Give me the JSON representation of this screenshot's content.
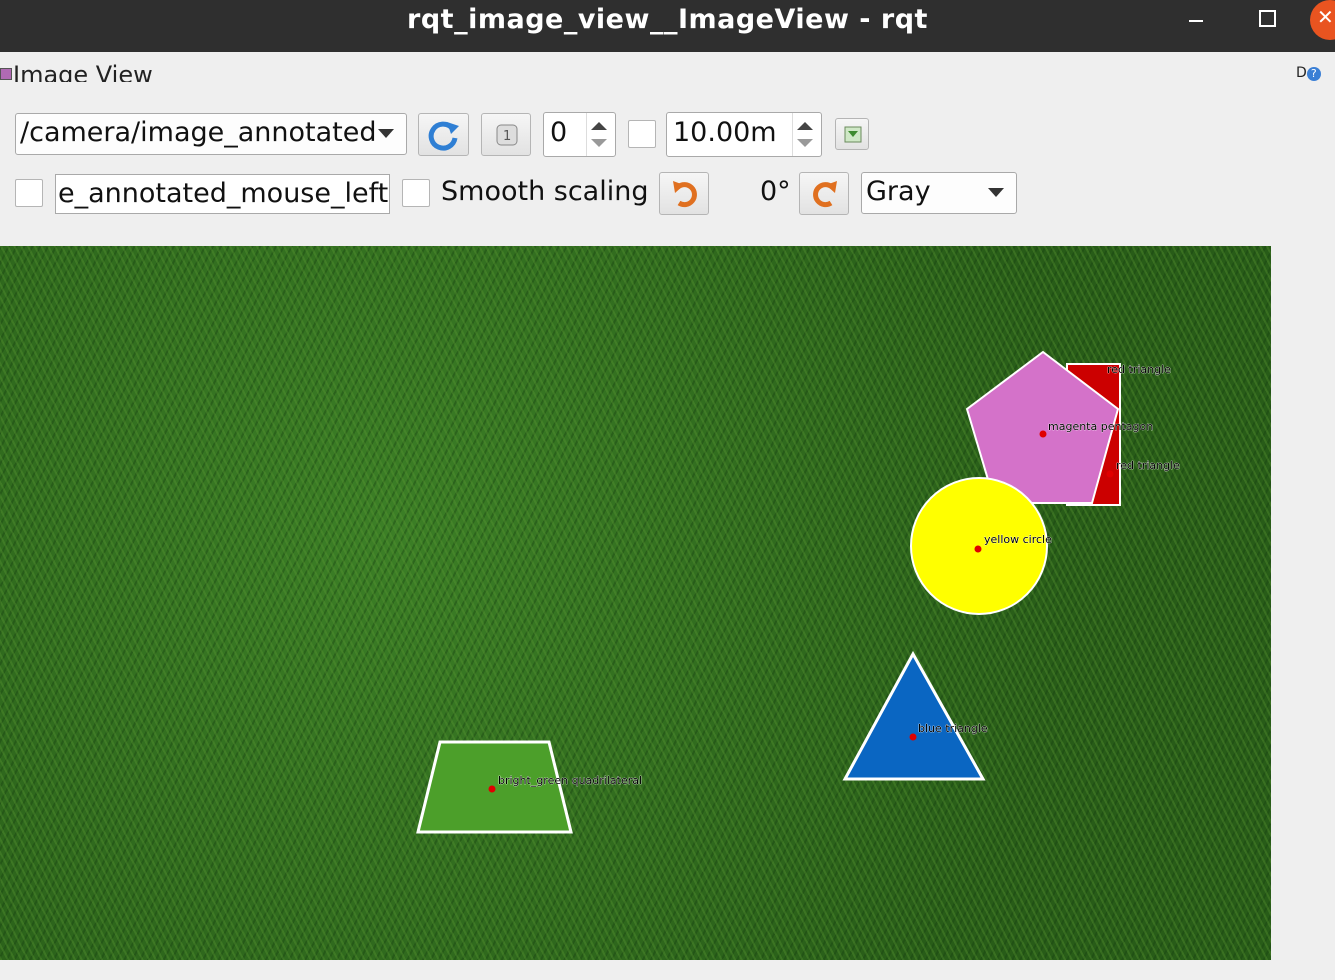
{
  "window": {
    "title": "rqt_image_view__ImageView - rqt"
  },
  "panel": {
    "title": "Image View",
    "help_text": "D"
  },
  "toolbar": {
    "topic": "/camera/image_annotated",
    "spin_value": "0",
    "duration": "10.00m",
    "mouse_topic": "e_annotated_mouse_left",
    "smooth_scaling_label": "Smooth scaling",
    "rotation": "0°",
    "color_scheme": "Gray"
  },
  "image": {
    "colors": {
      "yellow": "#ffff00",
      "magenta": "#d472c9",
      "red": "#cc0000",
      "blue": "#0a66c2",
      "green": "#4c9f2a"
    },
    "labels": {
      "red_triangle_1": "red triangle",
      "magenta_pentagon": "magenta pentagon",
      "red_triangle_2": "red triangle",
      "yellow_circle": "yellow circle",
      "blue_triangle": "blue triangle",
      "bright_green_quadrilateral": "bright_green quadrilateral"
    }
  }
}
